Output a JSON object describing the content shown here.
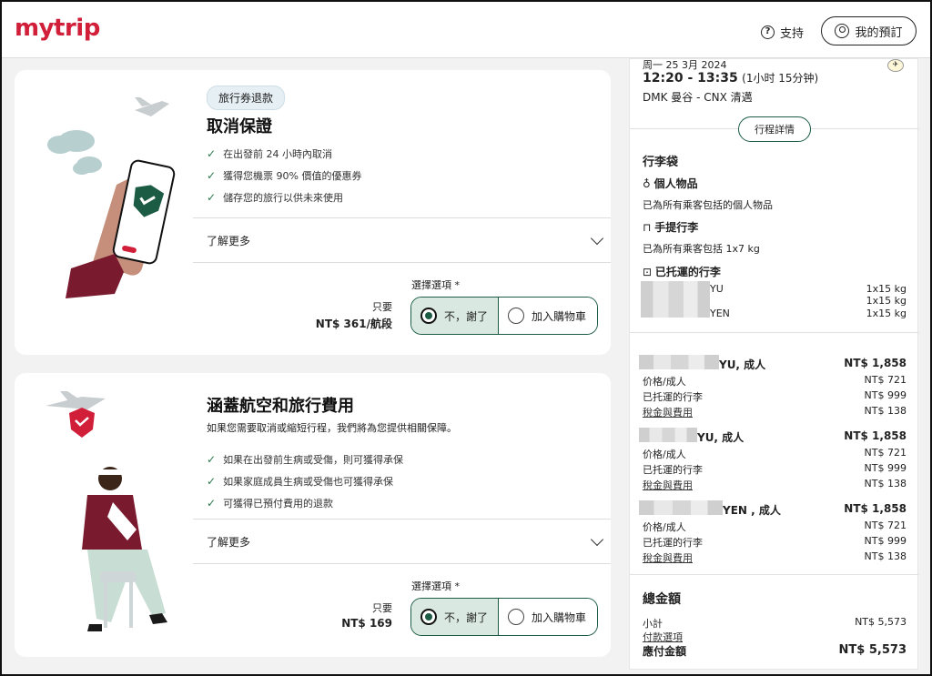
{
  "header": {
    "logo": "mytrip",
    "support_label": "支持",
    "bookings_label": "我的預訂"
  },
  "card1": {
    "badge": "旅行券退款",
    "title": "取消保證",
    "bullets": [
      "在出發前 24 小時內取消",
      "獲得您機票 90% 價值的優惠券",
      "儲存您的旅行以供未來使用"
    ],
    "learn_more": "了解更多",
    "select_label": "選擇選項 *",
    "price_prefix": "只要",
    "price": "NT$ 361/航段",
    "option_no": "不，謝了",
    "option_add": "加入購物車"
  },
  "card2": {
    "title": "涵蓋航空和旅行費用",
    "description": "如果您需要取消或縮短行程，我們將為您提供相關保障。",
    "bullets": [
      "如果在出發前生病或受傷，則可獲得承保",
      "如果家庭成員生病或受傷也可獲得承保",
      "可獲得已預付費用的退款"
    ],
    "learn_more": "了解更多",
    "select_label": "選擇選項 *",
    "price_prefix": "只要",
    "price": "NT$ 169",
    "option_no": "不，謝了",
    "option_add": "加入購物車"
  },
  "sidebar": {
    "date": "周一 25 3月 2024",
    "time": "12:20 - 13:35",
    "duration": "(1小时 15分钟)",
    "route": "DMK 曼谷 - CNX 清邁",
    "details_button": "行程詳情",
    "baggage": {
      "title": "行李袋",
      "personal_title": "個人物品",
      "personal_desc": "已為所有乘客包括的個人物品",
      "carry_title": "手提行李",
      "carry_desc": "已為所有乘客包括 1x7 kg",
      "checked_title": "已托運的行李",
      "checked": [
        {
          "name": "YU",
          "weight": "1x15 kg"
        },
        {
          "name": "",
          "weight": "1x15 kg"
        },
        {
          "name": "YEN",
          "weight": "1x15 kg"
        }
      ]
    },
    "passengers": [
      {
        "name": "YU, 成人",
        "total": "NT$ 1,858",
        "fare_label": "价格/成人",
        "fare": "NT$ 721",
        "bag_label": "已托運的行李",
        "bag": "NT$ 999",
        "tax_label": "稅金與費用",
        "tax": "NT$ 138"
      },
      {
        "name": "YU, 成人",
        "total": "NT$ 1,858",
        "fare_label": "价格/成人",
        "fare": "NT$ 721",
        "bag_label": "已托運的行李",
        "bag": "NT$ 999",
        "tax_label": "稅金與費用",
        "tax": "NT$ 138"
      },
      {
        "name": "YEN , 成人",
        "total": "NT$ 1,858",
        "fare_label": "价格/成人",
        "fare": "NT$ 721",
        "bag_label": "已托運的行李",
        "bag": "NT$ 999",
        "tax_label": "稅金與費用",
        "tax": "NT$ 138"
      }
    ],
    "total": {
      "title": "總金額",
      "subtotal_label": "小計",
      "subtotal": "NT$ 5,573",
      "payment_options": "付款選項",
      "due_label": "應付金額",
      "due": "NT$ 5,573"
    }
  }
}
